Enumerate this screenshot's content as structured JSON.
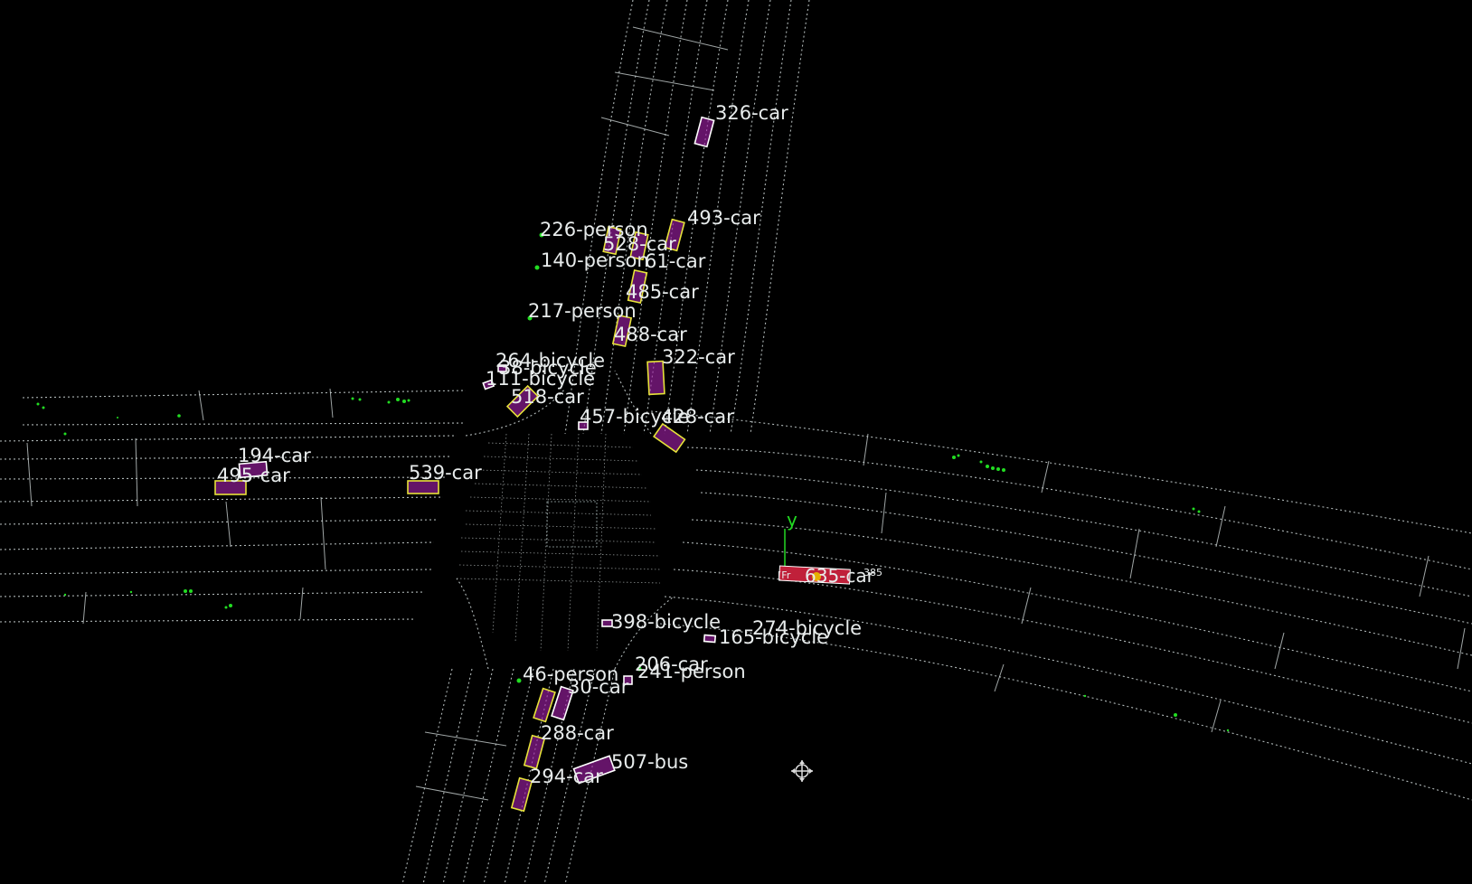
{
  "scene": {
    "background": "#000000",
    "lane_color": "#cfd8d8",
    "box_fill": "#9a1ea0",
    "box_stroke_default": "#ffffff",
    "box_stroke_highlight": "#e6e23a",
    "point_color": "#22dd22",
    "ego_color": "#c0203a"
  },
  "axis": {
    "y_label": "y"
  },
  "ego": {
    "label": "635-car",
    "tag_left": "[Fr",
    "tag_right": "385"
  },
  "cursor": {
    "icon": "move-cursor-icon"
  },
  "objects": [
    {
      "id": "326",
      "cls": "car",
      "text": "326-car"
    },
    {
      "id": "493",
      "cls": "car",
      "text": "493-car"
    },
    {
      "id": "226",
      "cls": "person",
      "text": "226-person"
    },
    {
      "id": "528",
      "cls": "car",
      "text": "528-car"
    },
    {
      "id": "140",
      "cls": "person",
      "text": "140-person"
    },
    {
      "id": "61",
      "cls": "car",
      "text": "61-car"
    },
    {
      "id": "485",
      "cls": "car",
      "text": "485-car"
    },
    {
      "id": "217",
      "cls": "person",
      "text": "217-person"
    },
    {
      "id": "488",
      "cls": "car",
      "text": "488-car"
    },
    {
      "id": "322",
      "cls": "car",
      "text": "322-car"
    },
    {
      "id": "264",
      "cls": "bicycle",
      "text": "264-bicycle"
    },
    {
      "id": "38",
      "cls": "bicycle",
      "text": "38-bicycle"
    },
    {
      "id": "111",
      "cls": "bicycle",
      "text": "111-bicycle"
    },
    {
      "id": "518",
      "cls": "car",
      "text": "518-car"
    },
    {
      "id": "457",
      "cls": "bicycle",
      "text": "457-bicycle"
    },
    {
      "id": "428",
      "cls": "car",
      "text": "428-car"
    },
    {
      "id": "194",
      "cls": "car",
      "text": "194-car"
    },
    {
      "id": "495",
      "cls": "car",
      "text": "495-car"
    },
    {
      "id": "539",
      "cls": "car",
      "text": "539-car"
    },
    {
      "id": "398",
      "cls": "bicycle",
      "text": "398-bicycle"
    },
    {
      "id": "274",
      "cls": "bicycle",
      "text": "274-bicycle"
    },
    {
      "id": "165",
      "cls": "bicycle",
      "text": "165-bicycle"
    },
    {
      "id": "206",
      "cls": "car",
      "text": "206-car"
    },
    {
      "id": "241",
      "cls": "person",
      "text": "241-person"
    },
    {
      "id": "46",
      "cls": "person",
      "text": "46-person"
    },
    {
      "id": "30",
      "cls": "car",
      "text": "30-car"
    },
    {
      "id": "288",
      "cls": "car",
      "text": "288-car"
    },
    {
      "id": "507",
      "cls": "bus",
      "text": "507-bus"
    },
    {
      "id": "294",
      "cls": "car",
      "text": "294-car"
    }
  ]
}
